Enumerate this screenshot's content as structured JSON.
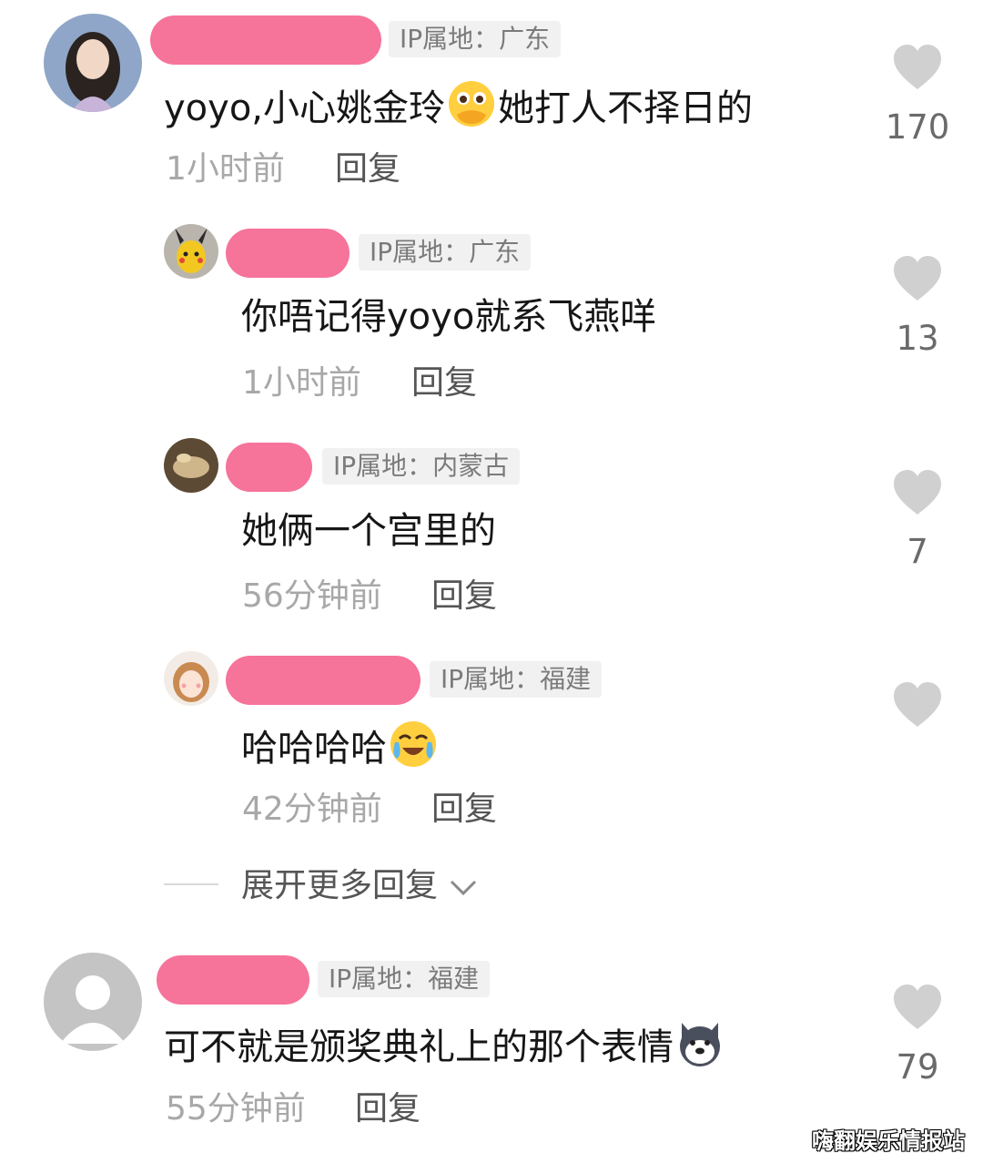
{
  "comments": [
    {
      "ip": "IP属地：广东",
      "text_before": "yoyo,小心姚金玲",
      "emoji": "covering-mouth-emoji",
      "text_after": "她打人不择日的",
      "time": "1小时前",
      "reply": "回复",
      "likes": "170",
      "replies": [
        {
          "ip": "IP属地：广东",
          "text": "你唔记得yoyo就系飞燕咩",
          "time": "1小时前",
          "reply": "回复",
          "likes": "13"
        },
        {
          "ip": "IP属地：内蒙古",
          "text": "她俩一个宫里的",
          "time": "56分钟前",
          "reply": "回复",
          "likes": "7"
        },
        {
          "ip": "IP属地：福建",
          "text": "哈哈哈哈",
          "emoji": "tears-of-joy-emoji",
          "time": "42分钟前",
          "reply": "回复",
          "likes": ""
        }
      ],
      "expand_more": "展开更多回复"
    },
    {
      "ip": "IP属地：福建",
      "text": "可不就是颁奖典礼上的那个表情",
      "emoji": "husky-dog-emoji",
      "time": "55分钟前",
      "reply": "回复",
      "likes": "79"
    }
  ],
  "watermark": "嗨翻娱乐情报站",
  "colors": {
    "name_blob": "#f6739a",
    "ip_badge_bg": "#f1f1f1",
    "like_icon": "#d0d0d0"
  }
}
